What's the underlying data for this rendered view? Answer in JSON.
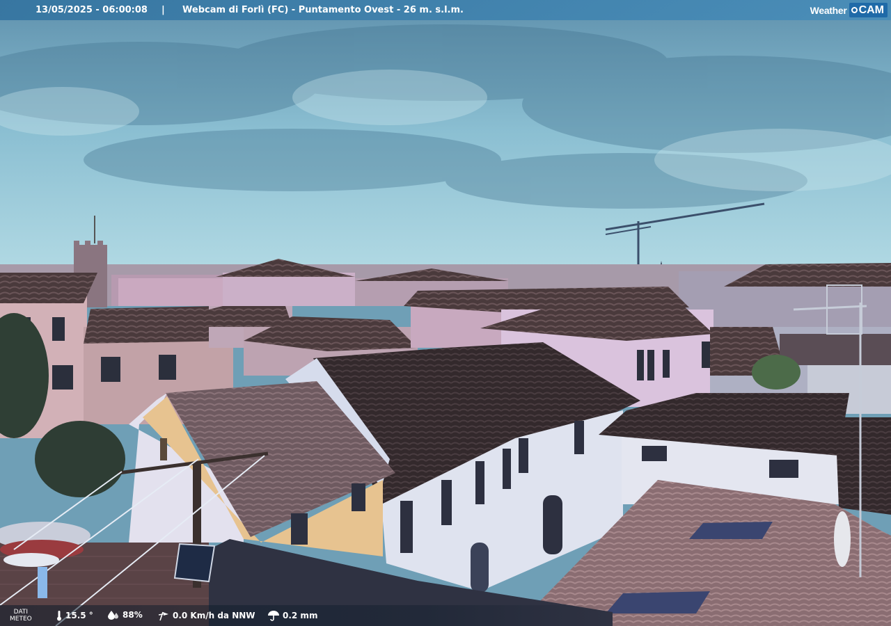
{
  "header": {
    "timestamp": "13/05/2025 - 06:00:08",
    "separator": "|",
    "caption": "Webcam di Forlì (FC) - Puntamento Ovest - 26 m. s.l.m.",
    "logo_word": "Weather",
    "logo_cam": "CAM"
  },
  "weather": {
    "section_label_top": "DATI",
    "section_label_bottom": "METEO",
    "temperature": "15.5 °",
    "humidity": "88%",
    "wind": "0.0 Km/h da NNW",
    "rain": "0.2 mm"
  },
  "icons": {
    "temperature": "thermometer-icon",
    "humidity": "humidity-drop-icon",
    "wind": "wind-icon",
    "rain": "umbrella-icon"
  },
  "colors": {
    "bar_blue": "#3474a0",
    "logo_blue": "#1f6aa8"
  }
}
